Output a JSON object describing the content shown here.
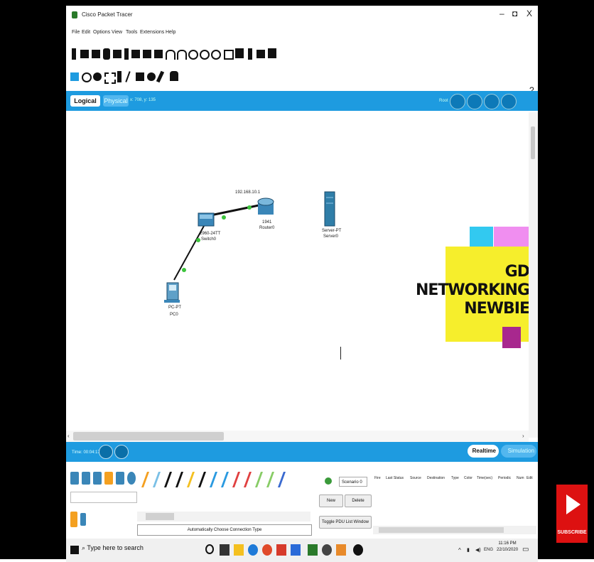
{
  "window": {
    "title": "Cisco Packet Tracer",
    "minimize": "–",
    "maximize": "◘",
    "close": "X",
    "help": "?"
  },
  "menu": [
    "File",
    "Edit",
    "Options",
    "View",
    "Tools",
    "Extensions",
    "Help"
  ],
  "workspace_tabs": {
    "logical": "Logical",
    "physical": "Physical",
    "coords": "x: 708, y: 135",
    "root": "Root"
  },
  "devices": {
    "router": {
      "ip": "192.168.10.1",
      "model": "1941",
      "name": "Router0"
    },
    "switch": {
      "model": "2960-24TT",
      "name": "Switch0"
    },
    "server": {
      "model": "Server-PT",
      "name": "Server0"
    },
    "pc": {
      "model": "PC-PT",
      "name": "PC0"
    }
  },
  "sticky_note": {
    "line1": "GD",
    "line2": "NETWORKING",
    "line3": "NEWBIE",
    "color_yellow": "#f6ee2c",
    "color_cyan": "#32c9f0",
    "color_pink": "#f08ef0",
    "color_purple": "#a8288e"
  },
  "bottom_bar": {
    "time": "Time: 00:04:17",
    "realtime": "Realtime",
    "simulation": "Simulation"
  },
  "connections_panel": {
    "auto_label": "Automatically Choose Connection Type"
  },
  "pdu_panel": {
    "scenario": "Scenario 0",
    "new": "New",
    "delete": "Delete",
    "toggle": "Toggle PDU List Window",
    "columns": [
      "Fire",
      "Last Status",
      "Source",
      "Destination",
      "Type",
      "Color",
      "Time(sec)",
      "Periodic",
      "Num",
      "Edit"
    ]
  },
  "taskbar": {
    "search_placeholder": "Type here to search",
    "lang": "ENG",
    "time": "11:16 PM",
    "date": "22/10/2020"
  },
  "overlay": {
    "subscribe": "SUBSCRIBE"
  },
  "accent_blue": "#1e9be0"
}
